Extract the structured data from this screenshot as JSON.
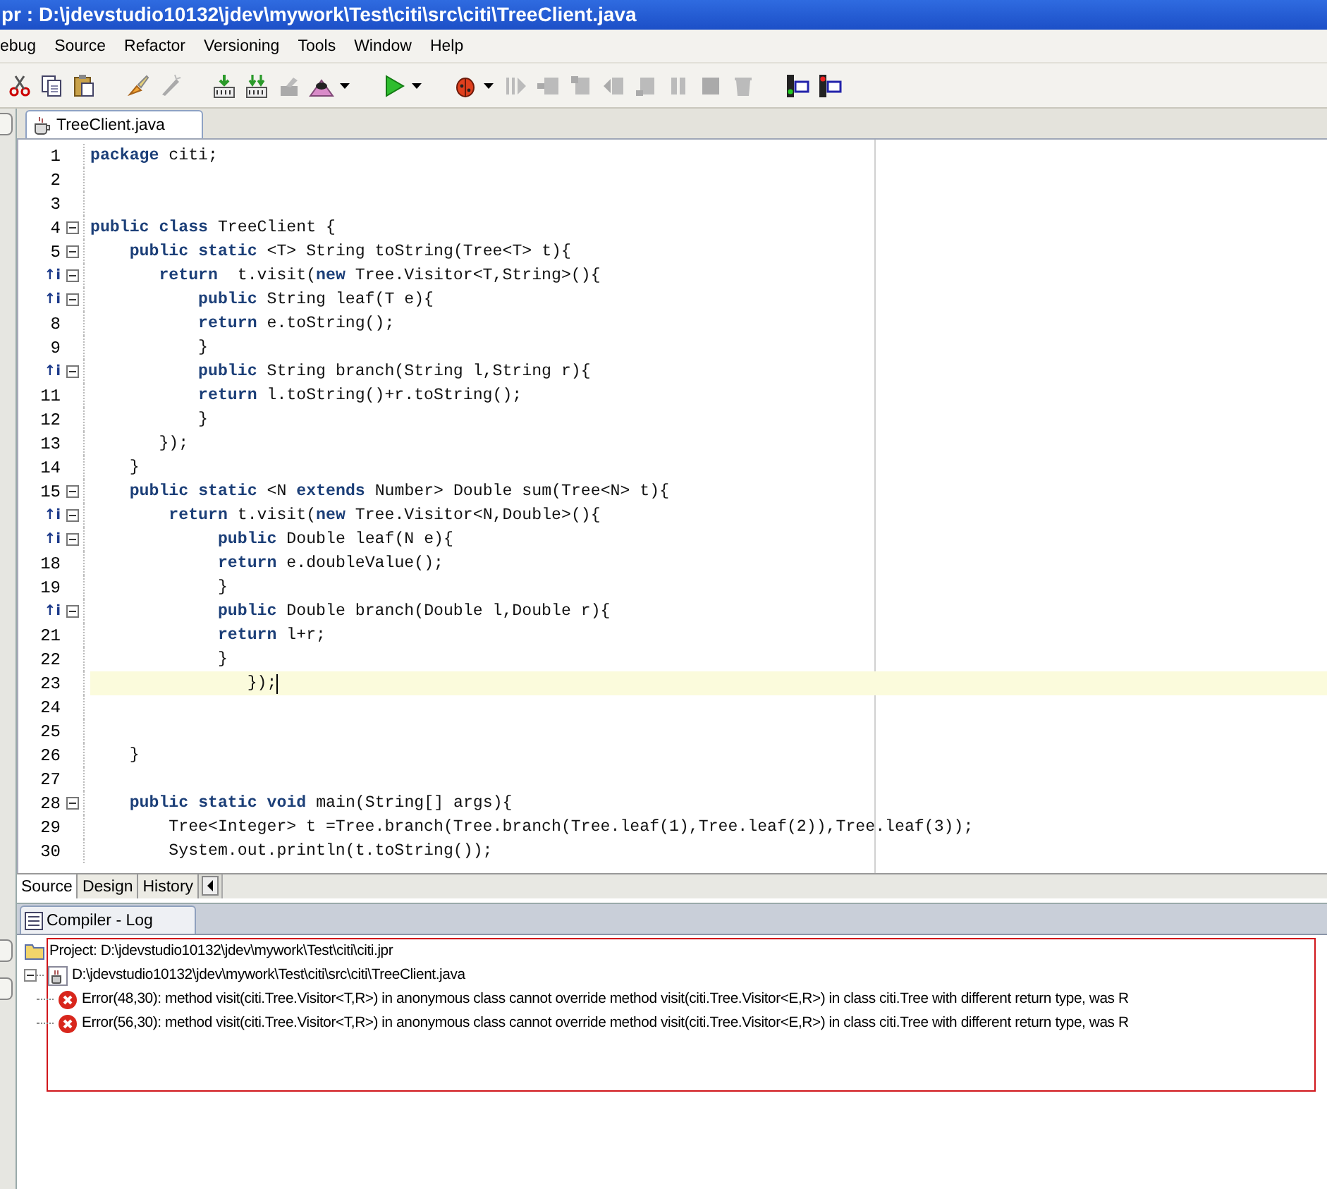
{
  "window": {
    "title": "pr : D:\\jdevstudio10132\\jdev\\mywork\\Test\\citi\\src\\citi\\TreeClient.java"
  },
  "menu": [
    "ebug",
    "Source",
    "Refactor",
    "Versioning",
    "Tools",
    "Window",
    "Help"
  ],
  "editor_tabs": [
    {
      "label": "TreeClient.java",
      "selected": true
    }
  ],
  "code": [
    {
      "number": "1",
      "code": "**package** citi;"
    },
    {
      "number": "2"
    },
    {
      "number": "3"
    },
    {
      "number": "4",
      "fold": true,
      "code": "**public** **class** TreeClient {"
    },
    {
      "number": "5",
      "fold": true,
      "code": "    **public** **static** <T> String toString(Tree<T> t){"
    },
    {
      "gutter_mark": "↑i",
      "fold": true,
      "code": "       **return**  t.visit(**new** Tree.Visitor<T,String>(){"
    },
    {
      "gutter_mark": "↑i",
      "fold": true,
      "code": "           **public** String leaf(T e){"
    },
    {
      "number": "8",
      "code": "           **return** e.toString();"
    },
    {
      "number": "9",
      "code": "           }"
    },
    {
      "gutter_mark": "↑i",
      "fold": true,
      "code": "           **public** String branch(String l,String r){"
    },
    {
      "number": "11",
      "code": "           **return** l.toString()+r.toString();"
    },
    {
      "number": "12",
      "code": "           }"
    },
    {
      "number": "13",
      "code": "       });"
    },
    {
      "number": "14",
      "code": "    }"
    },
    {
      "number": "15",
      "fold": true,
      "code": "    **public** **static** <N **extends** Number> Double sum(Tree<N> t){"
    },
    {
      "gutter_mark": "↑i",
      "fold": true,
      "code": "        **return** t.visit(**new** Tree.Visitor<N,Double>(){"
    },
    {
      "gutter_mark": "↑i",
      "fold": true,
      "code": "             **public** Double leaf(N e){"
    },
    {
      "number": "18",
      "code": "             **return** e.doubleValue();"
    },
    {
      "number": "19",
      "code": "             }"
    },
    {
      "gutter_mark": "↑i",
      "fold": true,
      "code": "             **public** Double branch(Double l,Double r){"
    },
    {
      "number": "21",
      "code": "             **return** l+r;"
    },
    {
      "number": "22",
      "code": "             }"
    },
    {
      "number": "23",
      "current": true,
      "code": "                });"
    },
    {
      "number": "24"
    },
    {
      "number": "25"
    },
    {
      "number": "26",
      "code": "    }"
    },
    {
      "number": "27"
    },
    {
      "number": "28",
      "fold": true,
      "code": "    **public** **static** **void** main(String[] args){"
    },
    {
      "number": "29",
      "code": "        Tree<Integer> t =Tree.branch(Tree.branch(Tree.leaf(1),Tree.leaf(2)),Tree.leaf(3));"
    },
    {
      "number": "30",
      "code": "        System.out.println(t.toString());"
    }
  ],
  "view_tabs": [
    {
      "label": "Source",
      "selected": true
    },
    {
      "label": "Design",
      "selected": false
    },
    {
      "label": "History",
      "selected": false
    }
  ],
  "log": {
    "tab": "Compiler - Log",
    "items": [
      {
        "kind": "project",
        "label": "Project: D:\\jdevstudio10132\\jdev\\mywork\\Test\\citi\\citi.jpr"
      },
      {
        "kind": "file",
        "expanded": true,
        "label": "D:\\jdevstudio10132\\jdev\\mywork\\Test\\citi\\src\\citi\\TreeClient.java",
        "children": [
          {
            "kind": "error",
            "label": "Error(48,30): method visit(citi.Tree.Visitor<T,R>) in anonymous class cannot override method visit(citi.Tree.Visitor<E,R>) in class citi.Tree with different return type, was R"
          },
          {
            "kind": "error",
            "label": "Error(56,30): method visit(citi.Tree.Visitor<T,R>) in anonymous class cannot override method visit(citi.Tree.Visitor<E,R>) in class citi.Tree with different return type, was R"
          }
        ]
      }
    ]
  }
}
